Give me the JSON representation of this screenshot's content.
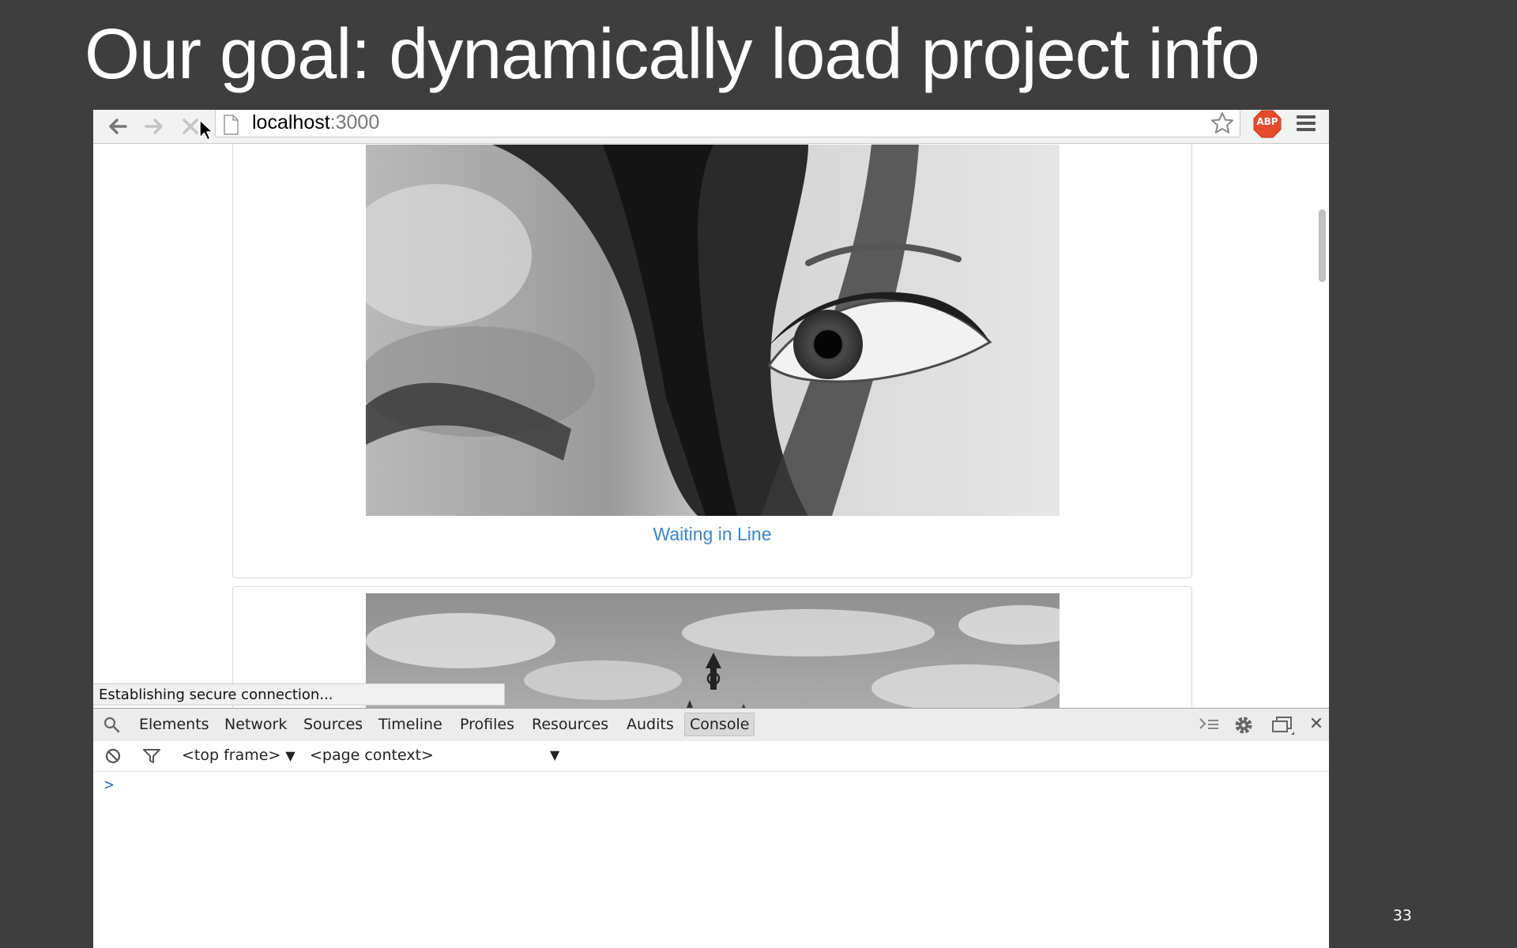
{
  "slide": {
    "title": "Our goal: dynamically load project info",
    "number": "33"
  },
  "browser": {
    "toolbar": {
      "back_icon": "arrow-left",
      "forward_icon": "arrow-right",
      "stop_icon": "close-x",
      "url_host": "localhost",
      "url_port": ":3000",
      "bookmark_icon": "star",
      "extension_label": "ABP",
      "menu_icon": "hamburger"
    },
    "page": {
      "cards": [
        {
          "caption": "Waiting in Line",
          "photo": "grayscale close-up of woman's eye"
        },
        {
          "caption": "",
          "photo": "grayscale sky with statue"
        }
      ],
      "link_color": "#3a86c8"
    },
    "status_bar": "Establishing secure connection..."
  },
  "devtools": {
    "tabs": [
      "Elements",
      "Network",
      "Sources",
      "Timeline",
      "Profiles",
      "Resources",
      "Audits",
      "Console"
    ],
    "active_tab": "Console",
    "frame_select": "<top frame>",
    "context_select": "<page context>",
    "prompt": ">"
  }
}
